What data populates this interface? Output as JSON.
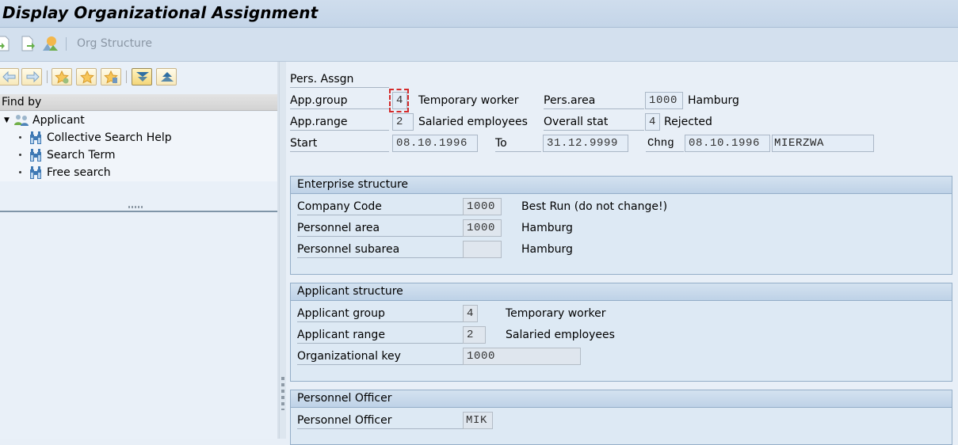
{
  "title": "Display Organizational Assignment",
  "toolbar": {
    "icons": [
      "previous-record-icon",
      "next-record-icon",
      "org-structure-icon"
    ],
    "org_structure_label": "Org Structure"
  },
  "navigator": {
    "buttons": [
      "back-arrow-icon",
      "forward-arrow-icon",
      "add-favorite-icon",
      "favorites-icon",
      "delete-favorite-icon",
      "expand-all-icon",
      "collapse-all-icon"
    ],
    "header": "Find by",
    "tree": {
      "root": "Applicant",
      "children": [
        "Collective Search Help",
        "Search Term",
        "Free search"
      ]
    }
  },
  "header": {
    "section_label": "Pers. Assgn",
    "app_group": {
      "label": "App.group",
      "value": "4",
      "text": "Temporary worker"
    },
    "app_range": {
      "label": "App.range",
      "value": "2",
      "text": "Salaried employees"
    },
    "pers_area": {
      "label": "Pers.area",
      "value": "1000",
      "text": "Hamburg"
    },
    "overall_stat": {
      "label": "Overall stat",
      "value": "4",
      "text": "Rejected"
    },
    "start": {
      "label": "Start",
      "value": "08.10.1996"
    },
    "to": {
      "label": "To",
      "value": "31.12.9999"
    },
    "chng": {
      "label": "Chng",
      "date": "08.10.1996",
      "user": "MIERZWA"
    }
  },
  "enterprise": {
    "title": "Enterprise structure",
    "rows": [
      {
        "label": "Company Code",
        "value": "1000",
        "text": "Best Run (do not change!)"
      },
      {
        "label": "Personnel area",
        "value": "1000",
        "text": "Hamburg"
      },
      {
        "label": "Personnel subarea",
        "value": "",
        "text": "Hamburg"
      }
    ]
  },
  "applicant": {
    "title": "Applicant structure",
    "rows": [
      {
        "label": "Applicant group",
        "value": "4",
        "text": "Temporary worker"
      },
      {
        "label": "Applicant range",
        "value": "2",
        "text": "Salaried employees"
      },
      {
        "label": "Organizational key",
        "value": "1000",
        "text": ""
      }
    ]
  },
  "officer": {
    "title": "Personnel Officer",
    "rows": [
      {
        "label": "Personnel Officer",
        "value": "MIK"
      }
    ]
  }
}
